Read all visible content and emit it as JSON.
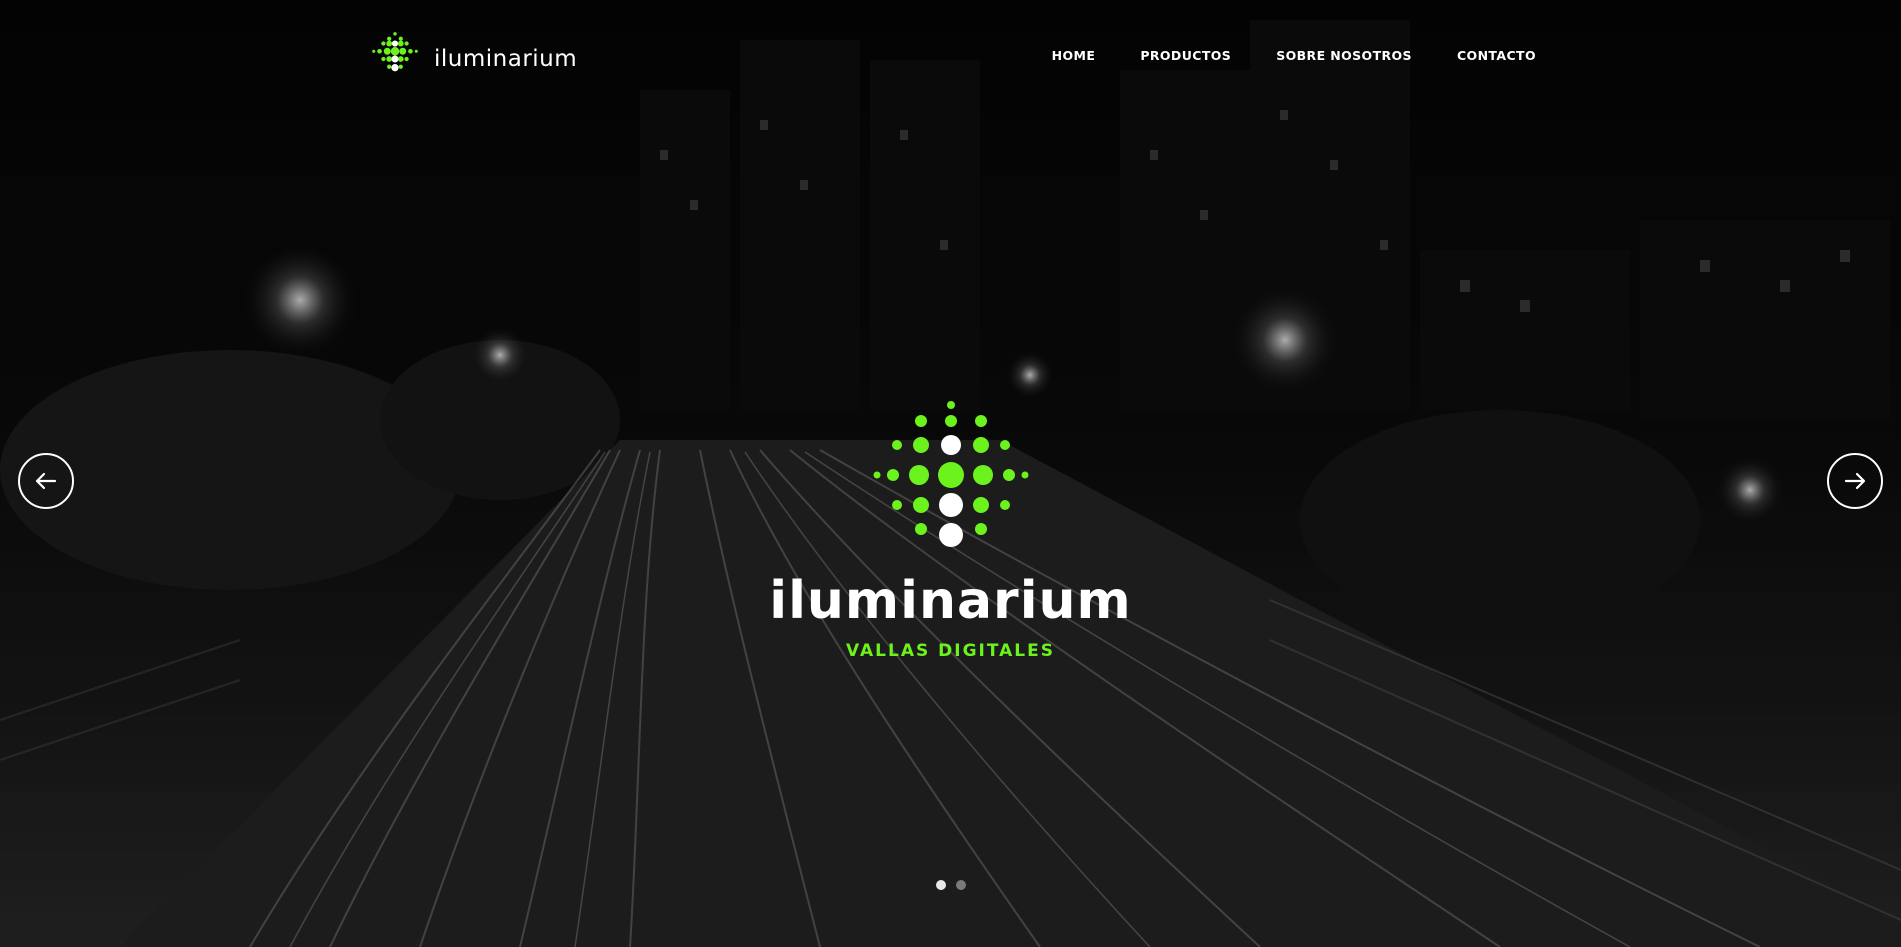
{
  "header": {
    "logo_text": "iluminarium",
    "nav": [
      {
        "label": "HOME"
      },
      {
        "label": "PRODUCTOS"
      },
      {
        "label": "SOBRE NOSOTROS"
      },
      {
        "label": "CONTACTO"
      }
    ]
  },
  "hero": {
    "title": "iluminarium",
    "subtitle": "VALLAS DIGITALES",
    "prev_icon": "arrow-left-icon",
    "next_icon": "arrow-right-icon",
    "slides_count": 2,
    "active_slide": 1
  },
  "colors": {
    "accent": "#6cf21c",
    "text": "#ffffff",
    "background": "#000000"
  }
}
